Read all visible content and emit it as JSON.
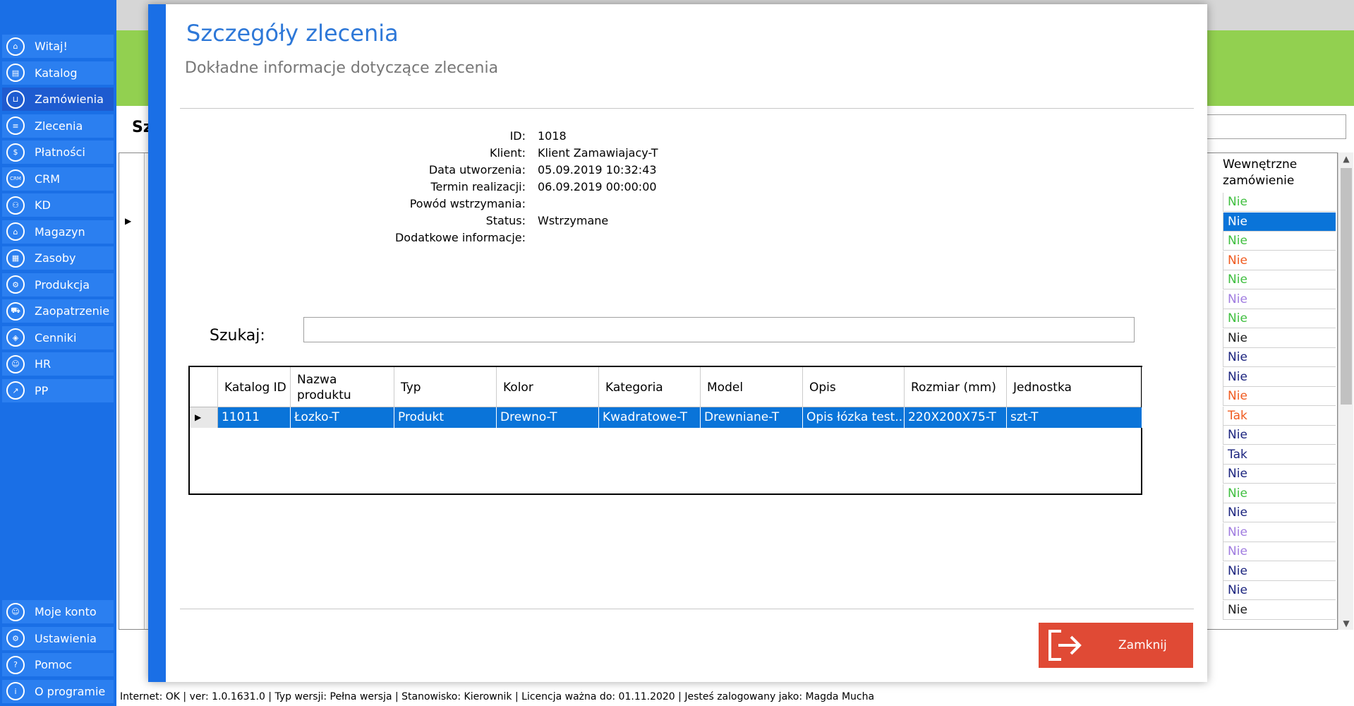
{
  "sidebar": {
    "items": [
      {
        "label": "Witaj!",
        "icon": "home-icon",
        "glyph": "⌂",
        "active": false
      },
      {
        "label": "Katalog",
        "icon": "book-icon",
        "glyph": "▤",
        "active": false
      },
      {
        "label": "Zamówienia",
        "icon": "cart-icon",
        "glyph": "⊔",
        "active": true
      },
      {
        "label": "Zlecenia",
        "icon": "list-icon",
        "glyph": "≡",
        "active": false
      },
      {
        "label": "Płatności",
        "icon": "dollar-icon",
        "glyph": "$",
        "active": false
      },
      {
        "label": "CRM",
        "icon": "crm-icon",
        "glyph": "CRM",
        "active": false
      },
      {
        "label": "KD",
        "icon": "person-lock-icon",
        "glyph": "⚇",
        "active": false
      },
      {
        "label": "Magazyn",
        "icon": "warehouse-icon",
        "glyph": "⌂",
        "active": false
      },
      {
        "label": "Zasoby",
        "icon": "resources-icon",
        "glyph": "▦",
        "active": false
      },
      {
        "label": "Produkcja",
        "icon": "production-icon",
        "glyph": "⚙",
        "active": false
      },
      {
        "label": "Zaopatrzenie",
        "icon": "truck-icon",
        "glyph": "⛟",
        "active": false
      },
      {
        "label": "Cenniki",
        "icon": "tag-icon",
        "glyph": "◈",
        "active": false
      },
      {
        "label": "HR",
        "icon": "hr-icon",
        "glyph": "☺",
        "active": false
      },
      {
        "label": "PP",
        "icon": "chart-icon",
        "glyph": "↗",
        "active": false
      }
    ],
    "bottom_items": [
      {
        "label": "Moje konto",
        "icon": "user-icon",
        "glyph": "☺"
      },
      {
        "label": "Ustawienia",
        "icon": "gear-icon",
        "glyph": "⚙"
      },
      {
        "label": "Pomoc",
        "icon": "help-icon",
        "glyph": "?"
      },
      {
        "label": "O programie",
        "icon": "info-icon",
        "glyph": "i"
      }
    ]
  },
  "background": {
    "search_label": "Sz",
    "column_header": "Wewnętrzne zamówienie",
    "rows": [
      {
        "value": "Nie",
        "color": "#3fbf3f"
      },
      {
        "value": "Nie",
        "color": "#ffffff",
        "selected": true
      },
      {
        "value": "Nie",
        "color": "#3fbf3f"
      },
      {
        "value": "Nie",
        "color": "#f05a1e"
      },
      {
        "value": "Nie",
        "color": "#3fbf3f"
      },
      {
        "value": "Nie",
        "color": "#a07ce0"
      },
      {
        "value": "Nie",
        "color": "#3fbf3f"
      },
      {
        "value": "Nie",
        "color": "#1a1a1a"
      },
      {
        "value": "Nie",
        "color": "#1a237e"
      },
      {
        "value": "Nie",
        "color": "#1a237e"
      },
      {
        "value": "Nie",
        "color": "#f05a1e"
      },
      {
        "value": "Tak",
        "color": "#f05a1e"
      },
      {
        "value": "Nie",
        "color": "#1a237e"
      },
      {
        "value": "Tak",
        "color": "#1a237e"
      },
      {
        "value": "Nie",
        "color": "#1a237e"
      },
      {
        "value": "Nie",
        "color": "#3fbf3f"
      },
      {
        "value": "Nie",
        "color": "#1a237e"
      },
      {
        "value": "Nie",
        "color": "#a07ce0"
      },
      {
        "value": "Nie",
        "color": "#a07ce0"
      },
      {
        "value": "Nie",
        "color": "#1a237e"
      },
      {
        "value": "Nie",
        "color": "#1a237e"
      },
      {
        "value": "Nie",
        "color": "#1a1a1a"
      }
    ]
  },
  "status_bar": "Internet: OK  |   ver: 1.0.1631.0   |   Typ wersji: Pełna wersja   |   Stanowisko: Kierownik   |   Licencja ważna do: 01.11.2020   |   Jesteś zalogowany jako: Magda Mucha",
  "modal": {
    "title": "Szczegóły zlecenia",
    "subtitle": "Dokładne informacje dotyczące zlecenia",
    "details": [
      {
        "label": "ID:",
        "value": "1018"
      },
      {
        "label": "Klient:",
        "value": "Klient Zamawiajacy-T"
      },
      {
        "label": "Data utworzenia:",
        "value": "05.09.2019 10:32:43"
      },
      {
        "label": "Termin realizacji:",
        "value": "06.09.2019 00:00:00"
      },
      {
        "label": "Powód wstrzymania:",
        "value": ""
      },
      {
        "label": "Status:",
        "value": "Wstrzymane"
      },
      {
        "label": "Dodatkowe informacje:",
        "value": ""
      }
    ],
    "search": {
      "label": "Szukaj:",
      "value": ""
    },
    "grid": {
      "columns": [
        "Katalog ID",
        "Nazwa produktu",
        "Typ",
        "Kolor",
        "Kategoria",
        "Model",
        "Opis",
        "Rozmiar (mm)",
        "Jednostka"
      ],
      "rows": [
        [
          "11011",
          "Łozko-T",
          "Produkt",
          "Drewno-T",
          "Kwadratowe-T",
          "Drewniane-T",
          "Opis łózka test...",
          "220X200X75-T",
          "szt-T"
        ]
      ]
    },
    "close_label": "Zamknij"
  },
  "colors": {
    "sidebar": "#1a6fe6",
    "accent": "#2e78d8",
    "selection": "#0a74d9",
    "close_button": "#e04a35",
    "green_band": "#92d050"
  }
}
